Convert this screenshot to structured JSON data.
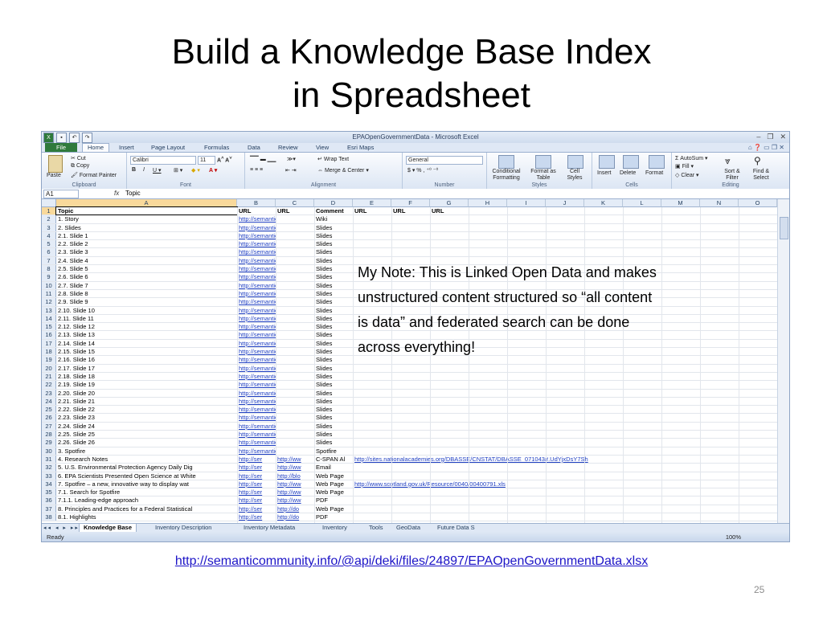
{
  "slide": {
    "title_line1": "Build a Knowledge Base Index",
    "title_line2": "in Spreadsheet",
    "note_lines": [
      "My Note: This is Linked Open Data and makes",
      "unstructured content structured so “all content",
      "is data” and federated search can be done",
      "across everything!"
    ],
    "url": "http://semanticommunity.info/@api/deki/files/24897/EPAOpenGovernmentData.xlsx",
    "page_number": "25"
  },
  "excel": {
    "window_title": "EPAOpenGovernmentData - Microsoft Excel",
    "ribbon_tabs": [
      "File",
      "Home",
      "Insert",
      "Page Layout",
      "Formulas",
      "Data",
      "Review",
      "View",
      "Esri Maps"
    ],
    "active_tab": "Home",
    "clipboard": {
      "cut": "Cut",
      "copy": "Copy",
      "format_painter": "Format Painter",
      "paste": "Paste",
      "label": "Clipboard"
    },
    "font": {
      "name": "Calibri",
      "size": "11",
      "label": "Font"
    },
    "alignment": {
      "wrap_text": "Wrap Text",
      "merge_center": "Merge & Center",
      "label": "Alignment"
    },
    "number": {
      "format": "General",
      "label": "Number"
    },
    "styles": {
      "conditional": "Conditional Formatting",
      "format_table": "Format as Table",
      "cell_styles": "Cell Styles",
      "label": "Styles"
    },
    "cells": {
      "insert": "Insert",
      "delete": "Delete",
      "format": "Format",
      "label": "Cells"
    },
    "editing": {
      "autosum": "AutoSum",
      "fill": "Fill",
      "clear": "Clear",
      "sort_filter": "Sort & Filter",
      "find_select": "Find & Select",
      "label": "Editing"
    },
    "name_box": "A1",
    "fx": "fx",
    "formula_content": "Topic",
    "columns": [
      "A",
      "B",
      "C",
      "D",
      "E",
      "F",
      "G",
      "H",
      "I",
      "J",
      "K",
      "L",
      "M",
      "N",
      "O"
    ],
    "rows": [
      {
        "n": "1",
        "a": "Topic",
        "b": "URL",
        "c": "URL",
        "d": "Comment",
        "e": "URL",
        "f": "URL",
        "g": "URL",
        "header": true
      },
      {
        "n": "2",
        "a": "1. Story",
        "b": "http://semanticomm",
        "d": "Wiki"
      },
      {
        "n": "3",
        "a": "2. Slides",
        "b": "http://semanticomm",
        "d": "Slides"
      },
      {
        "n": "4",
        "a": "2.1. Slide 1",
        "b": "http://semanticomm",
        "d": "Slides"
      },
      {
        "n": "5",
        "a": "2.2. Slide 2",
        "b": "http://semanticomm",
        "d": "Slides"
      },
      {
        "n": "6",
        "a": "2.3. Slide 3",
        "b": "http://semanticomm",
        "d": "Slides"
      },
      {
        "n": "7",
        "a": "2.4. Slide 4",
        "b": "http://semanticomm",
        "d": "Slides"
      },
      {
        "n": "8",
        "a": "2.5. Slide 5",
        "b": "http://semanticomm",
        "d": "Slides"
      },
      {
        "n": "9",
        "a": "2.6. Slide 6",
        "b": "http://semanticomm",
        "d": "Slides"
      },
      {
        "n": "10",
        "a": "2.7. Slide 7",
        "b": "http://semanticomm",
        "d": "Slides"
      },
      {
        "n": "11",
        "a": "2.8. Slide 8",
        "b": "http://semanticomm",
        "d": "Slides"
      },
      {
        "n": "12",
        "a": "2.9. Slide 9",
        "b": "http://semanticomm",
        "d": "Slides"
      },
      {
        "n": "13",
        "a": "2.10. Slide 10",
        "b": "http://semanticomm",
        "d": "Slides"
      },
      {
        "n": "14",
        "a": "2.11. Slide 11",
        "b": "http://semanticomm",
        "d": "Slides"
      },
      {
        "n": "15",
        "a": "2.12. Slide 12",
        "b": "http://semanticomm",
        "d": "Slides"
      },
      {
        "n": "16",
        "a": "2.13. Slide 13",
        "b": "http://semanticomm",
        "d": "Slides"
      },
      {
        "n": "17",
        "a": "2.14. Slide 14",
        "b": "http://semanticomm",
        "d": "Slides"
      },
      {
        "n": "18",
        "a": "2.15. Slide 15",
        "b": "http://semanticomm",
        "d": "Slides"
      },
      {
        "n": "19",
        "a": "2.16. Slide 16",
        "b": "http://semanticomm",
        "d": "Slides"
      },
      {
        "n": "20",
        "a": "2.17. Slide 17",
        "b": "http://semanticomm",
        "d": "Slides"
      },
      {
        "n": "21",
        "a": "2.18. Slide 18",
        "b": "http://semanticomm",
        "d": "Slides"
      },
      {
        "n": "22",
        "a": "2.19. Slide 19",
        "b": "http://semanticomm",
        "d": "Slides"
      },
      {
        "n": "23",
        "a": "2.20. Slide 20",
        "b": "http://semanticomm",
        "d": "Slides"
      },
      {
        "n": "24",
        "a": "2.21. Slide 21",
        "b": "http://semanticomm",
        "d": "Slides"
      },
      {
        "n": "25",
        "a": "2.22. Slide 22",
        "b": "http://semanticomm",
        "d": "Slides"
      },
      {
        "n": "26",
        "a": "2.23. Slide 23",
        "b": "http://semanticomm",
        "d": "Slides"
      },
      {
        "n": "27",
        "a": "2.24. Slide 24",
        "b": "http://semanticomm",
        "d": "Slides"
      },
      {
        "n": "28",
        "a": "2.25. Slide 25",
        "b": "http://semanticomm",
        "d": "Slides"
      },
      {
        "n": "29",
        "a": "2.26. Slide 26",
        "b": "http://semanticomm",
        "d": "Slides"
      },
      {
        "n": "30",
        "a": "3. Spotfire",
        "b": "http://semanticomm",
        "d": "Spotfire"
      },
      {
        "n": "31",
        "a": "4. Research Notes",
        "b": "http://ser",
        "c": "http://ww",
        "d": "C-SPAN Al",
        "e": "http://sites.nationalacademies.org/DBASSE/CNSTAT/DBASSE_071043#.UdYjxDsY7Sh"
      },
      {
        "n": "32",
        "a": "5. U.S. Environmental Protection Agency Daily Dig",
        "b": "http://ser",
        "c": "http://ww",
        "d": "Email"
      },
      {
        "n": "33",
        "a": "6. EPA Scientists Presented Open Science at White",
        "b": "http://ser",
        "c": "http://blo",
        "d": "Web Page"
      },
      {
        "n": "34",
        "a": "7. Spotfire – a new, innovative way to display wat",
        "b": "http://ser",
        "c": "http://ww",
        "d": "Web Page",
        "e": "http://www.scotland.gov.uk/Resource/0040/00400791.xls"
      },
      {
        "n": "35",
        "a": "7.1. Search for Spotfire",
        "b": "http://ser",
        "c": "http://ww",
        "d": "Web Page"
      },
      {
        "n": "36",
        "a": "7.1.1. Leading-edge approach",
        "b": "http://ser",
        "c": "http://ww",
        "d": "PDF"
      },
      {
        "n": "37",
        "a": "8. Principles and Practices for a Federal Statistical",
        "b": "http://ser",
        "c": "http://do",
        "d": "Web Page"
      },
      {
        "n": "38",
        "a": "8.1. Highlights",
        "b": "http://ser",
        "c": "http://do",
        "d": "PDF"
      }
    ],
    "sheet_tabs": [
      "Knowledge Base",
      "Inventory Description",
      "Inventory Metadata",
      "Inventory",
      "Tools",
      "GeoData",
      "Future Data S"
    ],
    "status": "Ready",
    "zoom": "100%"
  }
}
